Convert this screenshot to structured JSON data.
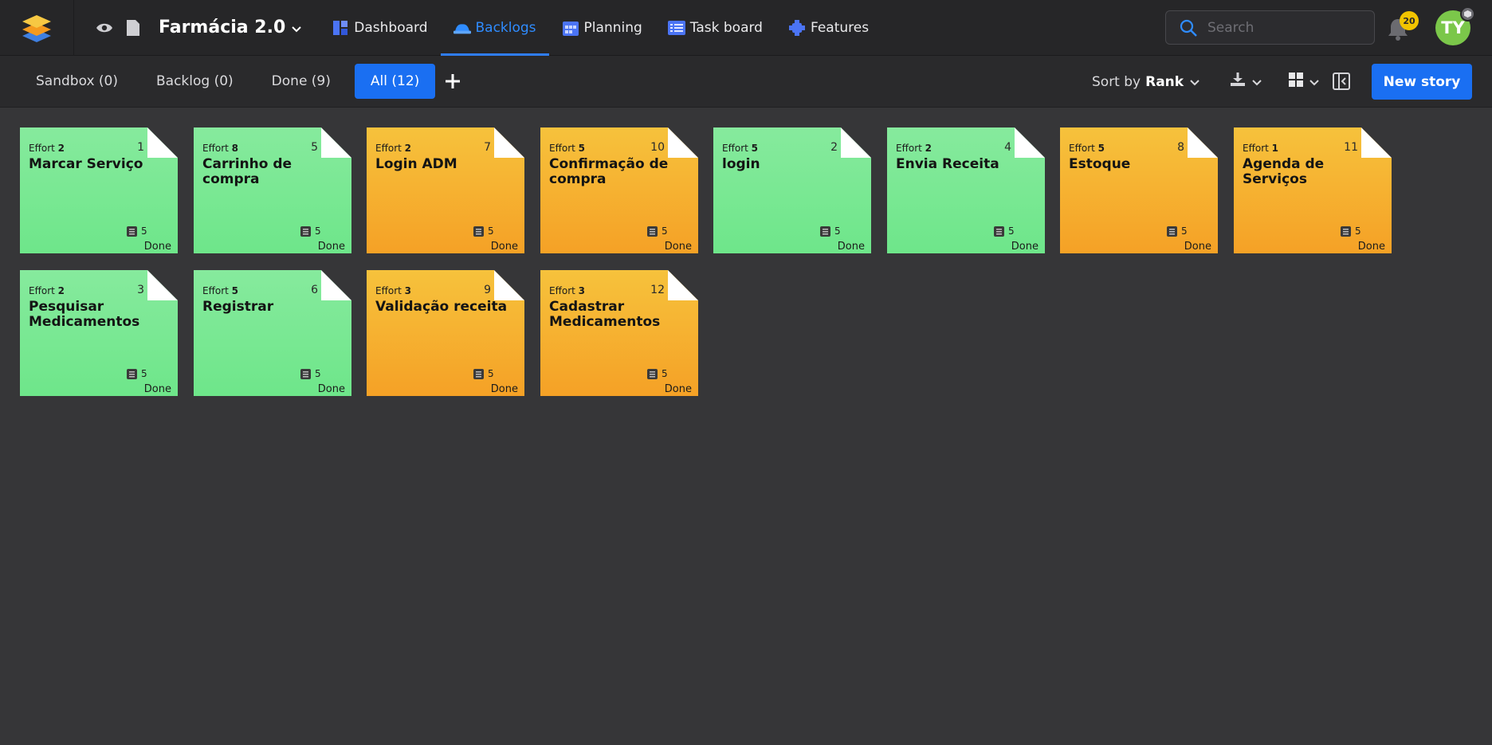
{
  "header": {
    "project_name": "Farmácia 2.0",
    "nav": [
      {
        "label": "Dashboard",
        "icon": "dashboard-icon",
        "active": false
      },
      {
        "label": "Backlogs",
        "icon": "backlogs-icon",
        "active": true
      },
      {
        "label": "Planning",
        "icon": "planning-icon",
        "active": false
      },
      {
        "label": "Task board",
        "icon": "taskboard-icon",
        "active": false
      },
      {
        "label": "Features",
        "icon": "features-icon",
        "active": false
      }
    ],
    "search_placeholder": "Search",
    "notification_count": "20",
    "avatar_initials": "TY"
  },
  "toolbar": {
    "filters": [
      {
        "label": "Sandbox (0)",
        "active": false
      },
      {
        "label": "Backlog (0)",
        "active": false
      },
      {
        "label": "Done (9)",
        "active": false
      },
      {
        "label": "All (12)",
        "active": true
      }
    ],
    "sort_prefix": "Sort by",
    "sort_value": "Rank",
    "new_story_label": "New story"
  },
  "colors": {
    "accent": "#1a6ff2",
    "card_green": "#7ce897",
    "card_orange": "#f5b030"
  },
  "cards": [
    {
      "effort_label": "Effort",
      "effort": "2",
      "number": "1",
      "title": "Marcar Serviço",
      "tasks": "5",
      "status": "Done",
      "color": "green"
    },
    {
      "effort_label": "Effort",
      "effort": "8",
      "number": "5",
      "title": "Carrinho de compra",
      "tasks": "5",
      "status": "Done",
      "color": "green"
    },
    {
      "effort_label": "Effort",
      "effort": "2",
      "number": "7",
      "title": "Login ADM",
      "tasks": "5",
      "status": "Done",
      "color": "orange"
    },
    {
      "effort_label": "Effort",
      "effort": "5",
      "number": "10",
      "title": "Confirmação de compra",
      "tasks": "5",
      "status": "Done",
      "color": "orange"
    },
    {
      "effort_label": "Effort",
      "effort": "5",
      "number": "2",
      "title": "login",
      "tasks": "5",
      "status": "Done",
      "color": "green"
    },
    {
      "effort_label": "Effort",
      "effort": "2",
      "number": "4",
      "title": "Envia Receita",
      "tasks": "5",
      "status": "Done",
      "color": "green"
    },
    {
      "effort_label": "Effort",
      "effort": "5",
      "number": "8",
      "title": "Estoque",
      "tasks": "5",
      "status": "Done",
      "color": "orange"
    },
    {
      "effort_label": "Effort",
      "effort": "1",
      "number": "11",
      "title": "Agenda de Serviços",
      "tasks": "5",
      "status": "Done",
      "color": "orange"
    },
    {
      "effort_label": "Effort",
      "effort": "2",
      "number": "3",
      "title": "Pesquisar Medicamentos",
      "tasks": "5",
      "status": "Done",
      "color": "green"
    },
    {
      "effort_label": "Effort",
      "effort": "5",
      "number": "6",
      "title": "Registrar",
      "tasks": "5",
      "status": "Done",
      "color": "green"
    },
    {
      "effort_label": "Effort",
      "effort": "3",
      "number": "9",
      "title": "Validação receita",
      "tasks": "5",
      "status": "Done",
      "color": "orange"
    },
    {
      "effort_label": "Effort",
      "effort": "3",
      "number": "12",
      "title": "Cadastrar Medicamentos",
      "tasks": "5",
      "status": "Done",
      "color": "orange"
    }
  ]
}
